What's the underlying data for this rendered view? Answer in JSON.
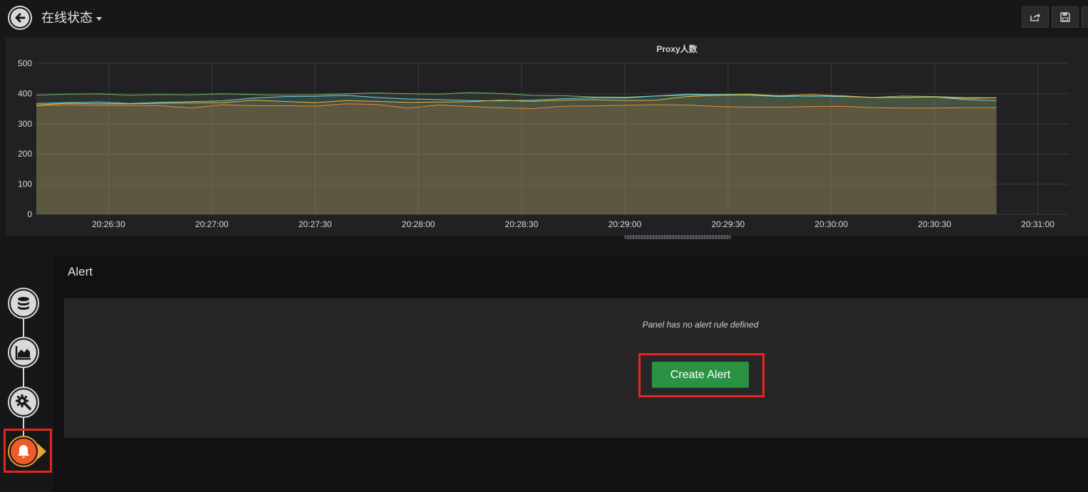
{
  "header": {
    "title": "在线状态",
    "buttons": [
      "share-icon",
      "save-icon"
    ]
  },
  "graph": {
    "title": "Proxy人数"
  },
  "chart_data": {
    "type": "line",
    "title": "Proxy人数",
    "xlabel": "",
    "ylabel": "",
    "ylim": [
      0,
      500
    ],
    "y_ticks": [
      "0",
      "100",
      "200",
      "300",
      "400",
      "500"
    ],
    "x_ticks": [
      "20:26:30",
      "20:27:00",
      "20:27:30",
      "20:28:00",
      "20:28:30",
      "20:29:00",
      "20:29:30",
      "20:30:00",
      "20:30:30",
      "20:31:00"
    ],
    "x_range": [
      "20:26:09",
      "20:31:09"
    ],
    "x": [
      "20:26:09",
      "20:26:18",
      "20:26:27",
      "20:26:36",
      "20:26:45",
      "20:26:54",
      "20:27:03",
      "20:27:12",
      "20:27:21",
      "20:27:30",
      "20:27:39",
      "20:27:48",
      "20:27:57",
      "20:28:06",
      "20:28:15",
      "20:28:24",
      "20:28:33",
      "20:28:42",
      "20:28:51",
      "20:29:00",
      "20:29:09",
      "20:29:18",
      "20:29:27",
      "20:29:36",
      "20:29:45",
      "20:29:54",
      "20:30:03",
      "20:30:12",
      "20:30:21",
      "20:30:30",
      "20:30:39",
      "20:30:48"
    ],
    "series": [
      {
        "color": "#7eb26d",
        "values": [
          395,
          398,
          399,
          395,
          397,
          396,
          399,
          397,
          395,
          396,
          399,
          402,
          399,
          398,
          403,
          400,
          394,
          393,
          389,
          388,
          392,
          394,
          397,
          398,
          393,
          391,
          393,
          387,
          392,
          390,
          387,
          386
        ]
      },
      {
        "color": "#6ed0e0",
        "values": [
          367,
          370,
          372,
          367,
          371,
          373,
          376,
          385,
          390,
          391,
          394,
          387,
          382,
          380,
          377,
          376,
          378,
          383,
          386,
          385,
          392,
          398,
          397,
          395,
          390,
          392,
          390,
          387,
          387,
          389,
          380,
          377
        ]
      },
      {
        "color": "#eab839",
        "values": [
          362,
          368,
          366,
          366,
          368,
          369,
          370,
          378,
          374,
          370,
          377,
          374,
          371,
          372,
          373,
          378,
          374,
          378,
          380,
          377,
          378,
          390,
          394,
          396,
          393,
          397,
          392,
          387,
          388,
          389,
          384,
          386
        ]
      },
      {
        "color": "#ef843c",
        "values": [
          360,
          363,
          361,
          361,
          360,
          352,
          363,
          360,
          360,
          358,
          366,
          364,
          352,
          362,
          357,
          353,
          350,
          358,
          359,
          361,
          363,
          362,
          357,
          355,
          355,
          357,
          358,
          353,
          352,
          352,
          353,
          353
        ]
      }
    ],
    "grid": true,
    "legend": "none"
  },
  "editor": {
    "steps": [
      {
        "id": "queries",
        "icon": "database-icon"
      },
      {
        "id": "visualization",
        "icon": "area-chart-icon"
      },
      {
        "id": "general",
        "icon": "cog-wrench-icon"
      },
      {
        "id": "alert",
        "icon": "bell-icon",
        "active": true
      }
    ]
  },
  "alert": {
    "heading": "Alert",
    "message": "Panel has no alert rule defined",
    "create_label": "Create Alert"
  }
}
